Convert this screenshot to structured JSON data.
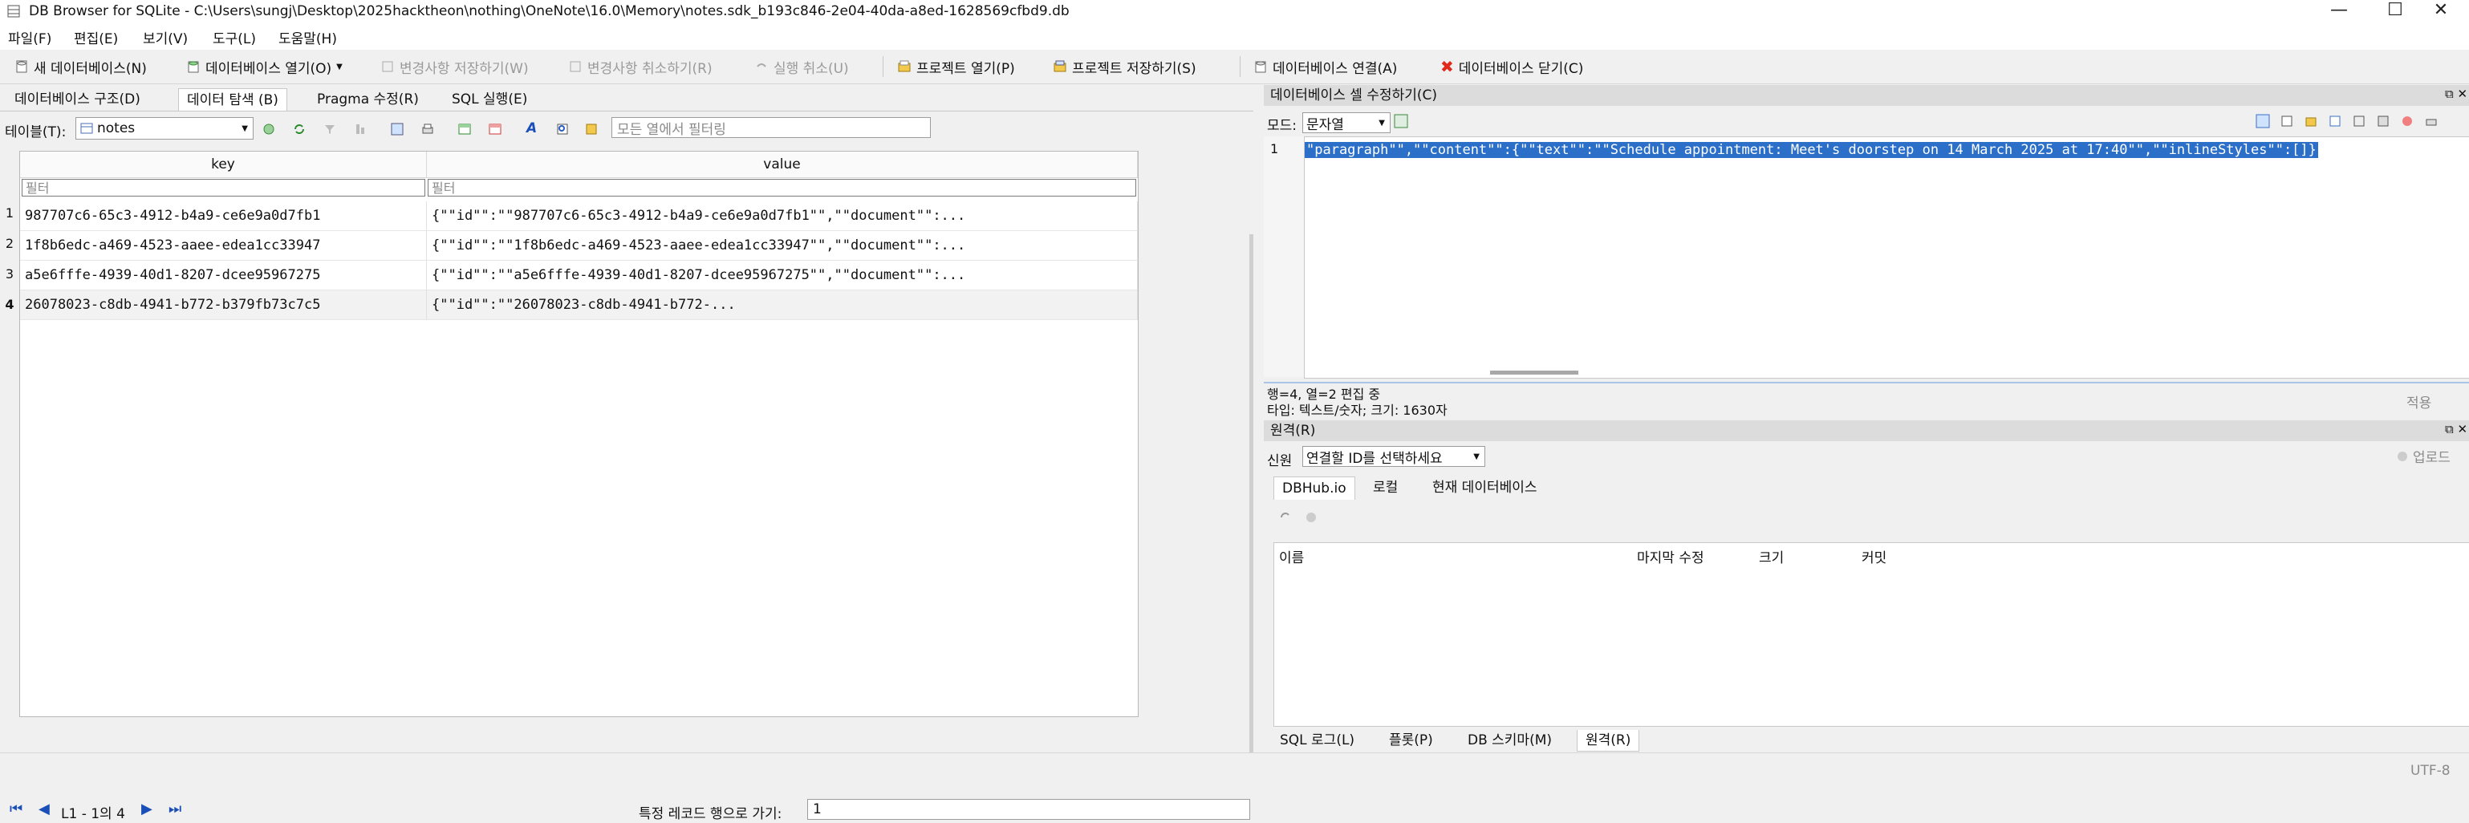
{
  "window": {
    "title": "DB Browser for SQLite - C:\\Users\\sungj\\Desktop\\2025hacktheon\\nothing\\OneNote\\16.0\\Memory\\notes.sdk_b193c846-2e04-40da-a8ed-1628569cfbd9.db",
    "minimize": "—",
    "maximize": "☐",
    "close": "✕"
  },
  "menu": [
    "파일(F)",
    "편집(E)",
    "보기(V)",
    "도구(L)",
    "도움말(H)"
  ],
  "toolbar": {
    "new_db": "새 데이터베이스(N)",
    "open_db": "데이터베이스 열기(O)",
    "write_changes": "변경사항 저장하기(W)",
    "revert_changes": "변경사항 취소하기(R)",
    "undo": "실행 취소(U)",
    "open_project": "프로젝트 열기(P)",
    "save_project": "프로젝트 저장하기(S)",
    "attach_db": "데이터베이스 연결(A)",
    "close_db": "데이터베이스 닫기(C)"
  },
  "left": {
    "tabs": [
      "데이터베이스 구조(D)",
      "데이터 탐색 (B)",
      "Pragma 수정(R)",
      "SQL 실행(E)"
    ],
    "table_label": "테이블(T):",
    "table_value": "notes",
    "filter_all_placeholder": "모든 열에서 필터링",
    "columns": [
      "key",
      "value"
    ],
    "filter_placeholder": "필터",
    "rows": [
      {
        "num": "1",
        "key": "987707c6-65c3-4912-b4a9-ce6e9a0d7fb1",
        "value": "{\"\"id\"\":\"\"987707c6-65c3-4912-b4a9-ce6e9a0d7fb1\"\",\"\"document\"\":..."
      },
      {
        "num": "2",
        "key": "1f8b6edc-a469-4523-aaee-edea1cc33947",
        "value": "{\"\"id\"\":\"\"1f8b6edc-a469-4523-aaee-edea1cc33947\"\",\"\"document\"\":..."
      },
      {
        "num": "3",
        "key": "a5e6fffe-4939-40d1-8207-dcee95967275",
        "value": "{\"\"id\"\":\"\"a5e6fffe-4939-40d1-8207-dcee95967275\"\",\"\"document\"\":..."
      },
      {
        "num": "4",
        "key": "26078023-c8db-4941-b772-b379fb73c7c5",
        "value": "{\"\"id\"\":\"\"26078023-c8db-4941-b772-..."
      }
    ],
    "nav_status": "L1 - 1의 4",
    "goto_label": "특정 레코드 행으로 가기:",
    "goto_value": "1"
  },
  "right": {
    "cell_editor_title": "데이터베이스 셀 수정하기(C)",
    "mode_label": "모드:",
    "mode_value": "문자열",
    "line_number": "1",
    "editor_text": "\"paragraph\"\",\"\"content\"\":{\"\"text\"\":\"\"Schedule appointment: Meet's doorstep on 14 March 2025 at 17:40\"\",\"\"inlineStyles\"\":[]}",
    "info_line1": "행=4, 열=2 편집 중",
    "info_line2": "타입: 텍스트/숫자; 크기: 1630자",
    "apply": "적용",
    "remote_title": "원격(R)",
    "identity_label": "신원",
    "identity_value": "연결할 ID를 선택하세요",
    "upload": "업로드",
    "remote_tabs": [
      "DBHub.io",
      "로컬",
      "현재 데이터베이스"
    ],
    "remote_columns": [
      "이름",
      "마지막 수정",
      "크기",
      "커밋"
    ],
    "bottom_tabs": [
      "SQL 로그(L)",
      "플롯(P)",
      "DB 스키마(M)",
      "원격(R)"
    ]
  },
  "status": {
    "encoding": "UTF-8"
  }
}
